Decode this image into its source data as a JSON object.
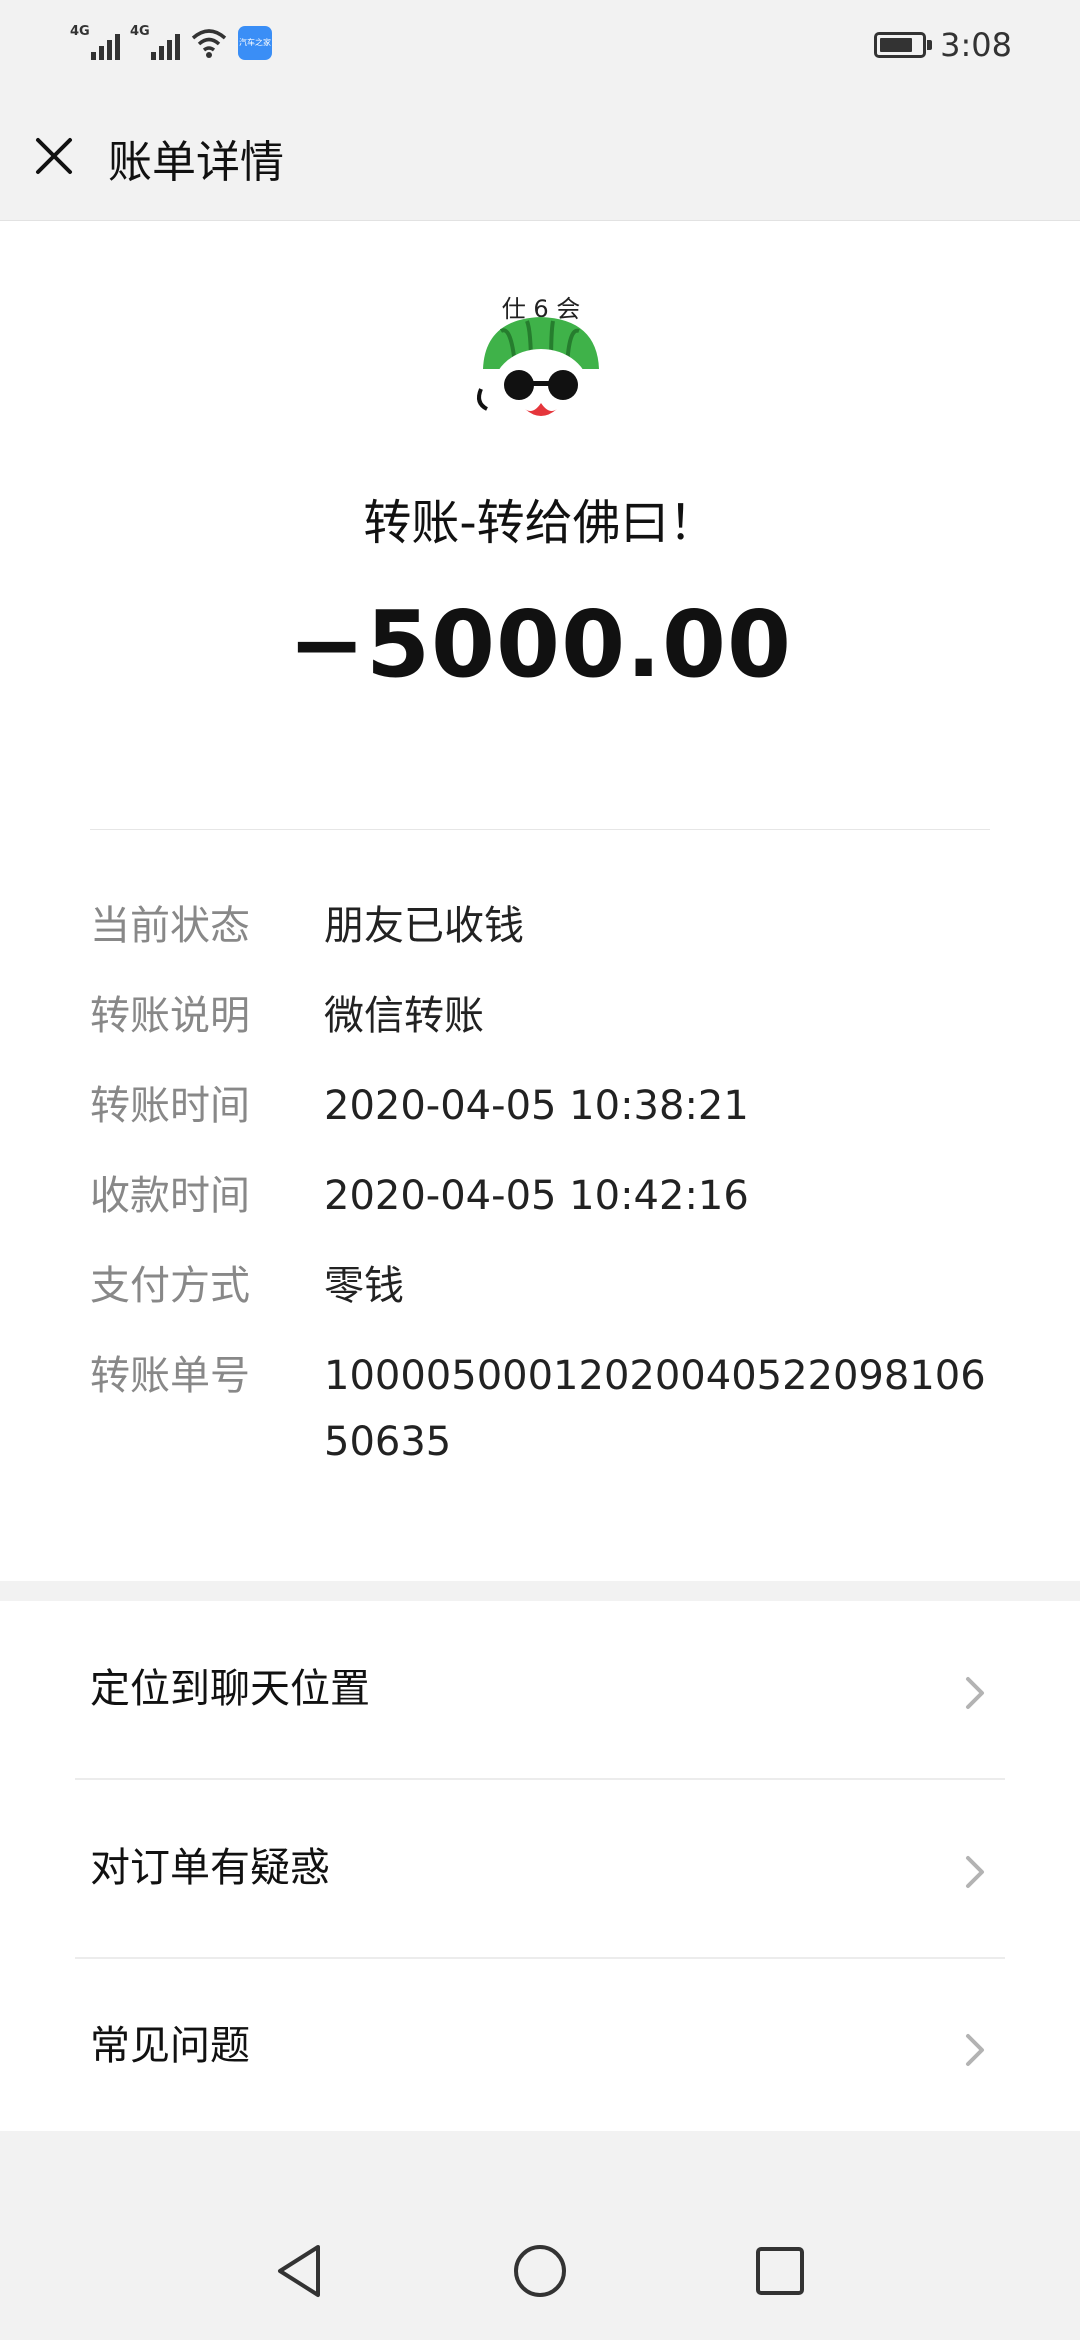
{
  "status_bar": {
    "network_1": "4G",
    "network_2": "4G",
    "app_badge": "汽车之家",
    "battery_level": 0.8,
    "time": "3:08"
  },
  "header": {
    "close_icon": "close-icon",
    "title": "账单详情"
  },
  "transaction": {
    "avatar_text": "仕 6 会",
    "title": "转账-转给佛曰！",
    "amount": "−5000.00"
  },
  "details": [
    {
      "label": "当前状态",
      "value": "朋友已收钱"
    },
    {
      "label": "转账说明",
      "value": "微信转账"
    },
    {
      "label": "转账时间",
      "value": "2020-04-05 10:38:21"
    },
    {
      "label": "收款时间",
      "value": "2020-04-05 10:42:16"
    },
    {
      "label": "支付方式",
      "value": "零钱"
    },
    {
      "label": "转账单号",
      "value": "1000050001202004052209810650635"
    }
  ],
  "menu": [
    {
      "label": "定位到聊天位置",
      "icon": "chevron-right-icon"
    },
    {
      "label": "对订单有疑惑",
      "icon": "chevron-right-icon"
    },
    {
      "label": "常见问题",
      "icon": "chevron-right-icon"
    }
  ],
  "nav": {
    "back_icon": "back-triangle-icon",
    "home_icon": "home-circle-icon",
    "recents_icon": "recents-square-icon"
  },
  "colors": {
    "background": "#f2f2f2",
    "card": "#ffffff",
    "label": "#888888",
    "text": "#111111",
    "avatar_green": "#3fb249"
  }
}
